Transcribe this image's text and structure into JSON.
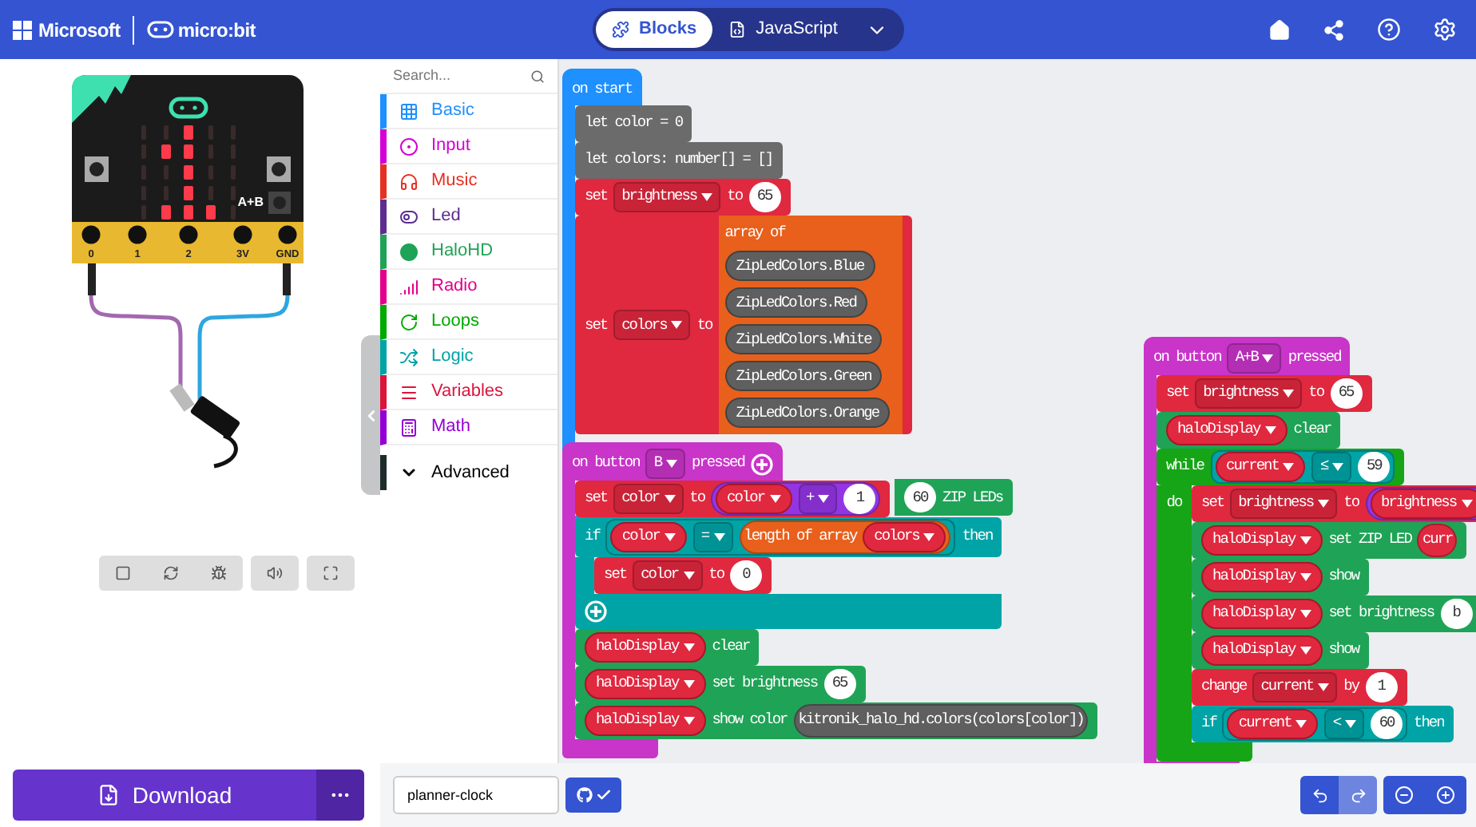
{
  "header": {
    "brand": "Microsoft",
    "product": "micro:bit",
    "tabs": [
      {
        "label": "Blocks",
        "selected": true
      },
      {
        "label": "JavaScript",
        "selected": false
      }
    ]
  },
  "simulator": {
    "leds": [
      [
        false,
        false,
        true,
        false,
        false
      ],
      [
        false,
        true,
        true,
        false,
        false
      ],
      [
        false,
        false,
        true,
        false,
        false
      ],
      [
        false,
        false,
        true,
        false,
        false
      ],
      [
        false,
        true,
        true,
        true,
        false
      ]
    ],
    "ab_label": "A+B",
    "pins": [
      "0",
      "1",
      "2",
      "3V",
      "GND"
    ]
  },
  "toolbox": {
    "search": {
      "placeholder": "Search..."
    },
    "categories": [
      {
        "label": "Basic",
        "color": "#1e90ff"
      },
      {
        "label": "Input",
        "color": "#d400d4"
      },
      {
        "label": "Music",
        "color": "#e63022"
      },
      {
        "label": "Led",
        "color": "#5c2d91"
      },
      {
        "label": "HaloHD",
        "color": "#1fa356"
      },
      {
        "label": "Radio",
        "color": "#e3008c"
      },
      {
        "label": "Loops",
        "color": "#00aa00"
      },
      {
        "label": "Logic",
        "color": "#00a4a6"
      },
      {
        "label": "Variables",
        "color": "#dc143c"
      },
      {
        "label": "Math",
        "color": "#9400d3"
      }
    ],
    "advanced": {
      "label": "Advanced"
    }
  },
  "workspace": {
    "stacks": [
      {
        "kind": "hat",
        "color": "#1e90ff",
        "tokens": [
          {
            "kind": "text",
            "text": "on start"
          }
        ],
        "children": [
          {
            "kind": "statement",
            "color": "#6b6b6b",
            "tokens": [
              {
                "kind": "text",
                "text": "let color = 0"
              }
            ]
          },
          {
            "kind": "statement",
            "color": "#6b6b6b",
            "tokens": [
              {
                "kind": "text",
                "text": "let colors: number[] = []"
              }
            ]
          },
          {
            "kind": "statement",
            "color": "#e0283f",
            "tokens": [
              {
                "kind": "text",
                "text": "set"
              },
              {
                "kind": "field",
                "text": "brightness"
              },
              {
                "kind": "text",
                "text": "to"
              },
              {
                "kind": "number",
                "text": "65"
              }
            ]
          },
          {
            "kind": "statement",
            "color": "#e0283f",
            "tokens": [
              {
                "kind": "text",
                "text": "set"
              },
              {
                "kind": "field",
                "text": "colors"
              },
              {
                "kind": "text",
                "text": "to"
              },
              {
                "kind": "array",
                "color": "#e8601c",
                "label": "array of",
                "items": [
                  "ZipLedColors.Blue",
                  "ZipLedColors.Red",
                  "ZipLedColors.White",
                  "ZipLedColors.Green",
                  "ZipLedColors.Orange"
                ]
              }
            ]
          },
          {
            "kind": "clipped",
            "color": "#1fa356",
            "tokens": [
              {
                "kind": "number",
                "text": "60"
              },
              {
                "kind": "text",
                "text": "ZIP LEDs"
              }
            ]
          }
        ]
      },
      {
        "kind": "hat",
        "color": "#c934c9",
        "tokens": [
          {
            "kind": "text",
            "text": "on button"
          },
          {
            "kind": "field",
            "text": "B"
          },
          {
            "kind": "text",
            "text": "pressed"
          },
          {
            "kind": "plus"
          }
        ],
        "children": [
          {
            "kind": "statement",
            "color": "#e0283f",
            "tokens": [
              {
                "kind": "text",
                "text": "set"
              },
              {
                "kind": "field",
                "text": "color"
              },
              {
                "kind": "text",
                "text": "to"
              },
              {
                "kind": "reporter",
                "color": "#9435e3",
                "tokens": [
                  {
                    "kind": "variable",
                    "text": "color"
                  },
                  {
                    "kind": "field",
                    "text": "+"
                  },
                  {
                    "kind": "number",
                    "text": "1"
                  }
                ]
              }
            ]
          },
          {
            "kind": "if",
            "color": "#00a4a6",
            "tokens": [
              {
                "kind": "text",
                "text": "if"
              },
              {
                "kind": "condition",
                "color": "#00a4a6",
                "tokens": [
                  {
                    "kind": "variable",
                    "text": "color"
                  },
                  {
                    "kind": "field",
                    "text": "="
                  },
                  {
                    "kind": "reporter",
                    "color": "#e8601c",
                    "tokens": [
                      {
                        "kind": "text",
                        "text": "length of array"
                      },
                      {
                        "kind": "variable",
                        "text": "colors"
                      }
                    ]
                  }
                ]
              },
              {
                "kind": "text",
                "text": "then"
              }
            ],
            "children": [
              {
                "kind": "statement",
                "color": "#e0283f",
                "tokens": [
                  {
                    "kind": "text",
                    "text": "set"
                  },
                  {
                    "kind": "field",
                    "text": "color"
                  },
                  {
                    "kind": "text",
                    "text": "to"
                  },
                  {
                    "kind": "number",
                    "text": "0"
                  }
                ]
              }
            ]
          },
          {
            "kind": "statement",
            "color": "#1fa356",
            "tokens": [
              {
                "kind": "variable",
                "text": "haloDisplay"
              },
              {
                "kind": "text",
                "text": "clear"
              }
            ]
          },
          {
            "kind": "statement",
            "color": "#1fa356",
            "tokens": [
              {
                "kind": "variable",
                "text": "haloDisplay"
              },
              {
                "kind": "text",
                "text": "set brightness"
              },
              {
                "kind": "number",
                "text": "65"
              }
            ]
          },
          {
            "kind": "statement",
            "color": "#1fa356",
            "tokens": [
              {
                "kind": "variable",
                "text": "haloDisplay"
              },
              {
                "kind": "text",
                "text": "show color"
              },
              {
                "kind": "reporter",
                "color": "#5f5f5f",
                "tokens": [
                  {
                    "kind": "text",
                    "text": "kitronik_halo_hd.colors(colors[color])"
                  }
                ]
              }
            ]
          }
        ]
      },
      {
        "kind": "hat",
        "color": "#c934c9",
        "tokens": [
          {
            "kind": "text",
            "text": "on button"
          },
          {
            "kind": "field",
            "text": "A+B"
          },
          {
            "kind": "text",
            "text": "pressed"
          }
        ],
        "children": [
          {
            "kind": "statement",
            "color": "#e0283f",
            "tokens": [
              {
                "kind": "text",
                "text": "set"
              },
              {
                "kind": "field",
                "text": "brightness"
              },
              {
                "kind": "text",
                "text": "to"
              },
              {
                "kind": "number",
                "text": "65"
              }
            ]
          },
          {
            "kind": "statement",
            "color": "#1fa356",
            "tokens": [
              {
                "kind": "variable",
                "text": "haloDisplay"
              },
              {
                "kind": "text",
                "text": "clear"
              }
            ]
          },
          {
            "kind": "loop",
            "color": "#16a516",
            "body_label": "do",
            "tokens": [
              {
                "kind": "text",
                "text": "while"
              },
              {
                "kind": "condition",
                "color": "#00a4a6",
                "tokens": [
                  {
                    "kind": "variable",
                    "text": "current"
                  },
                  {
                    "kind": "field",
                    "text": "≤"
                  },
                  {
                    "kind": "number",
                    "text": "59"
                  }
                ]
              }
            ],
            "children": [
              {
                "kind": "statement",
                "color": "#e0283f",
                "tokens": [
                  {
                    "kind": "text",
                    "text": "set"
                  },
                  {
                    "kind": "field",
                    "text": "brightness"
                  },
                  {
                    "kind": "text",
                    "text": "to"
                  },
                  {
                    "kind": "reporter",
                    "color": "#9435e3",
                    "tokens": [
                      {
                        "kind": "variable",
                        "text": "brightness"
                      }
                    ]
                  }
                ]
              },
              {
                "kind": "statement",
                "color": "#1fa356",
                "tokens": [
                  {
                    "kind": "variable",
                    "text": "haloDisplay"
                  },
                  {
                    "kind": "text",
                    "text": "set ZIP LED"
                  },
                  {
                    "kind": "reporter",
                    "color": "#e0283f",
                    "tokens": [
                      {
                        "kind": "text",
                        "text": "curr"
                      }
                    ]
                  }
                ]
              },
              {
                "kind": "statement",
                "color": "#1fa356",
                "tokens": [
                  {
                    "kind": "variable",
                    "text": "haloDisplay"
                  },
                  {
                    "kind": "text",
                    "text": "show"
                  }
                ]
              },
              {
                "kind": "statement",
                "color": "#1fa356",
                "tokens": [
                  {
                    "kind": "variable",
                    "text": "haloDisplay"
                  },
                  {
                    "kind": "text",
                    "text": "set brightness"
                  },
                  {
                    "kind": "number",
                    "text": "b"
                  }
                ]
              },
              {
                "kind": "statement",
                "color": "#1fa356",
                "tokens": [
                  {
                    "kind": "variable",
                    "text": "haloDisplay"
                  },
                  {
                    "kind": "text",
                    "text": "show"
                  }
                ]
              },
              {
                "kind": "statement",
                "color": "#e0283f",
                "tokens": [
                  {
                    "kind": "text",
                    "text": "change"
                  },
                  {
                    "kind": "field",
                    "text": "current"
                  },
                  {
                    "kind": "text",
                    "text": "by"
                  },
                  {
                    "kind": "number",
                    "text": "1"
                  }
                ]
              },
              {
                "kind": "statement",
                "color": "#00a4a6",
                "tokens": [
                  {
                    "kind": "text",
                    "text": "if"
                  },
                  {
                    "kind": "condition",
                    "color": "#00a4a6",
                    "tokens": [
                      {
                        "kind": "variable",
                        "text": "current"
                      },
                      {
                        "kind": "field",
                        "text": "<"
                      },
                      {
                        "kind": "number",
                        "text": "60"
                      }
                    ]
                  },
                  {
                    "kind": "text",
                    "text": "then"
                  }
                ]
              }
            ]
          }
        ]
      }
    ]
  },
  "footer": {
    "download": "Download",
    "project_name": "planner-clock",
    "undo": {
      "disabled": false
    },
    "redo": {
      "disabled": true
    }
  }
}
